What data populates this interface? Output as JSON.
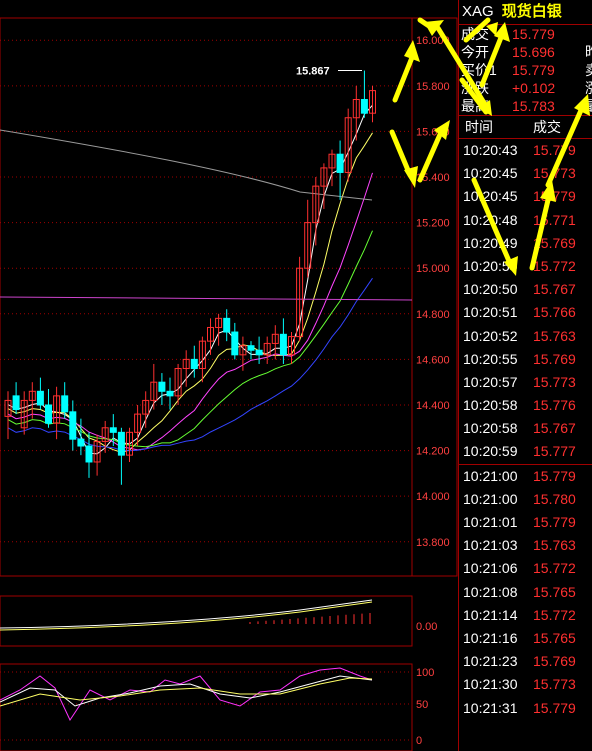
{
  "instrument": {
    "code": "XAG",
    "name": "现货白银"
  },
  "quote": [
    {
      "label": "成交",
      "value": "15.779",
      "extra": ""
    },
    {
      "label": "今开",
      "value": "15.696",
      "extra": "昨"
    },
    {
      "label": "买价1",
      "value": "15.779",
      "extra": "卖"
    },
    {
      "label": "涨跌",
      "value": "+0.102",
      "extra": "涨"
    },
    {
      "label": "最高",
      "value": "15.783",
      "extra": "最"
    }
  ],
  "tape_header": {
    "time": "时间",
    "price": "成交"
  },
  "tape": [
    {
      "time": "10:20:43",
      "price": "15.779"
    },
    {
      "time": "10:20:45",
      "price": "15.773"
    },
    {
      "time": "10:20:45",
      "price": "15.779"
    },
    {
      "time": "10:20:48",
      "price": "15.771"
    },
    {
      "time": "10:20:49",
      "price": "15.769"
    },
    {
      "time": "10:20:50",
      "price": "15.772"
    },
    {
      "time": "10:20:50",
      "price": "15.767"
    },
    {
      "time": "10:20:51",
      "price": "15.766"
    },
    {
      "time": "10:20:52",
      "price": "15.763"
    },
    {
      "time": "10:20:55",
      "price": "15.769"
    },
    {
      "time": "10:20:57",
      "price": "15.773"
    },
    {
      "time": "10:20:58",
      "price": "15.776"
    },
    {
      "time": "10:20:58",
      "price": "15.767"
    },
    {
      "time": "10:20:59",
      "price": "15.777"
    },
    {
      "time": "10:21:00",
      "price": "15.779"
    },
    {
      "time": "10:21:00",
      "price": "15.780"
    },
    {
      "time": "10:21:01",
      "price": "15.779"
    },
    {
      "time": "10:21:03",
      "price": "15.763"
    },
    {
      "time": "10:21:06",
      "price": "15.772"
    },
    {
      "time": "10:21:08",
      "price": "15.765"
    },
    {
      "time": "10:21:14",
      "price": "15.772"
    },
    {
      "time": "10:21:16",
      "price": "15.765"
    },
    {
      "time": "10:21:23",
      "price": "15.769"
    },
    {
      "time": "10:21:30",
      "price": "15.773"
    },
    {
      "time": "10:21:31",
      "price": "15.779"
    }
  ],
  "colors": {
    "up": "#ff3030",
    "down": "#00ffff",
    "grid": "#a00000",
    "annotation_arrow": "#ffff00"
  },
  "chart_data": {
    "type": "candlestick",
    "price_axis_ticks": [
      "16.000",
      "15.800",
      "15.600",
      "15.400",
      "15.200",
      "15.000",
      "14.800",
      "14.600",
      "14.400",
      "14.200",
      "14.000",
      "13.800"
    ],
    "price_range": [
      13.72,
      16.08
    ],
    "high_marker": "15.867",
    "volume_axis_label": "0.00",
    "oscillator_axis_ticks": [
      "100",
      "50",
      "0"
    ],
    "candles": [
      {
        "o": 14.35,
        "h": 14.46,
        "l": 14.25,
        "c": 14.42
      },
      {
        "o": 14.44,
        "h": 14.5,
        "l": 14.36,
        "c": 14.38
      },
      {
        "o": 14.3,
        "h": 14.46,
        "l": 14.27,
        "c": 14.42
      },
      {
        "o": 14.42,
        "h": 14.5,
        "l": 14.34,
        "c": 14.46
      },
      {
        "o": 14.46,
        "h": 14.52,
        "l": 14.38,
        "c": 14.4
      },
      {
        "o": 14.4,
        "h": 14.47,
        "l": 14.3,
        "c": 14.32
      },
      {
        "o": 14.32,
        "h": 14.48,
        "l": 14.25,
        "c": 14.44
      },
      {
        "o": 14.44,
        "h": 14.5,
        "l": 14.34,
        "c": 14.37
      },
      {
        "o": 14.37,
        "h": 14.42,
        "l": 14.2,
        "c": 14.25
      },
      {
        "o": 14.25,
        "h": 14.34,
        "l": 14.18,
        "c": 14.22
      },
      {
        "o": 14.22,
        "h": 14.28,
        "l": 14.08,
        "c": 14.15
      },
      {
        "o": 14.15,
        "h": 14.27,
        "l": 14.09,
        "c": 14.24
      },
      {
        "o": 14.24,
        "h": 14.33,
        "l": 14.19,
        "c": 14.3
      },
      {
        "o": 14.3,
        "h": 14.36,
        "l": 14.22,
        "c": 14.28
      },
      {
        "o": 14.28,
        "h": 14.3,
        "l": 14.05,
        "c": 14.18
      },
      {
        "o": 14.18,
        "h": 14.3,
        "l": 14.15,
        "c": 14.28
      },
      {
        "o": 14.28,
        "h": 14.4,
        "l": 14.22,
        "c": 14.36
      },
      {
        "o": 14.36,
        "h": 14.46,
        "l": 14.3,
        "c": 14.42
      },
      {
        "o": 14.42,
        "h": 14.58,
        "l": 14.38,
        "c": 14.5
      },
      {
        "o": 14.5,
        "h": 14.54,
        "l": 14.4,
        "c": 14.46
      },
      {
        "o": 14.46,
        "h": 14.52,
        "l": 14.38,
        "c": 14.44
      },
      {
        "o": 14.44,
        "h": 14.58,
        "l": 14.4,
        "c": 14.56
      },
      {
        "o": 14.56,
        "h": 14.64,
        "l": 14.48,
        "c": 14.6
      },
      {
        "o": 14.6,
        "h": 14.66,
        "l": 14.52,
        "c": 14.56
      },
      {
        "o": 14.56,
        "h": 14.7,
        "l": 14.5,
        "c": 14.68
      },
      {
        "o": 14.68,
        "h": 14.78,
        "l": 14.62,
        "c": 14.74
      },
      {
        "o": 14.74,
        "h": 14.8,
        "l": 14.66,
        "c": 14.78
      },
      {
        "o": 14.78,
        "h": 14.82,
        "l": 14.68,
        "c": 14.72
      },
      {
        "o": 14.72,
        "h": 14.76,
        "l": 14.6,
        "c": 14.62
      },
      {
        "o": 14.62,
        "h": 14.7,
        "l": 14.55,
        "c": 14.66
      },
      {
        "o": 14.66,
        "h": 14.68,
        "l": 14.6,
        "c": 14.64
      },
      {
        "o": 14.64,
        "h": 14.7,
        "l": 14.58,
        "c": 14.62
      },
      {
        "o": 14.62,
        "h": 14.7,
        "l": 14.58,
        "c": 14.67
      },
      {
        "o": 14.67,
        "h": 14.75,
        "l": 14.6,
        "c": 14.71
      },
      {
        "o": 14.71,
        "h": 14.78,
        "l": 14.58,
        "c": 14.62
      },
      {
        "o": 14.62,
        "h": 14.72,
        "l": 14.58,
        "c": 14.7
      },
      {
        "o": 14.7,
        "h": 15.05,
        "l": 14.68,
        "c": 15.0
      },
      {
        "o": 15.0,
        "h": 15.3,
        "l": 14.96,
        "c": 15.2
      },
      {
        "o": 15.2,
        "h": 15.4,
        "l": 15.1,
        "c": 15.36
      },
      {
        "o": 15.36,
        "h": 15.46,
        "l": 15.26,
        "c": 15.44
      },
      {
        "o": 15.44,
        "h": 15.52,
        "l": 15.36,
        "c": 15.5
      },
      {
        "o": 15.5,
        "h": 15.56,
        "l": 15.3,
        "c": 15.42
      },
      {
        "o": 15.42,
        "h": 15.7,
        "l": 15.38,
        "c": 15.66
      },
      {
        "o": 15.66,
        "h": 15.8,
        "l": 15.56,
        "c": 15.74
      },
      {
        "o": 15.74,
        "h": 15.867,
        "l": 15.66,
        "c": 15.68
      },
      {
        "o": 15.68,
        "h": 15.8,
        "l": 15.64,
        "c": 15.779
      }
    ]
  }
}
